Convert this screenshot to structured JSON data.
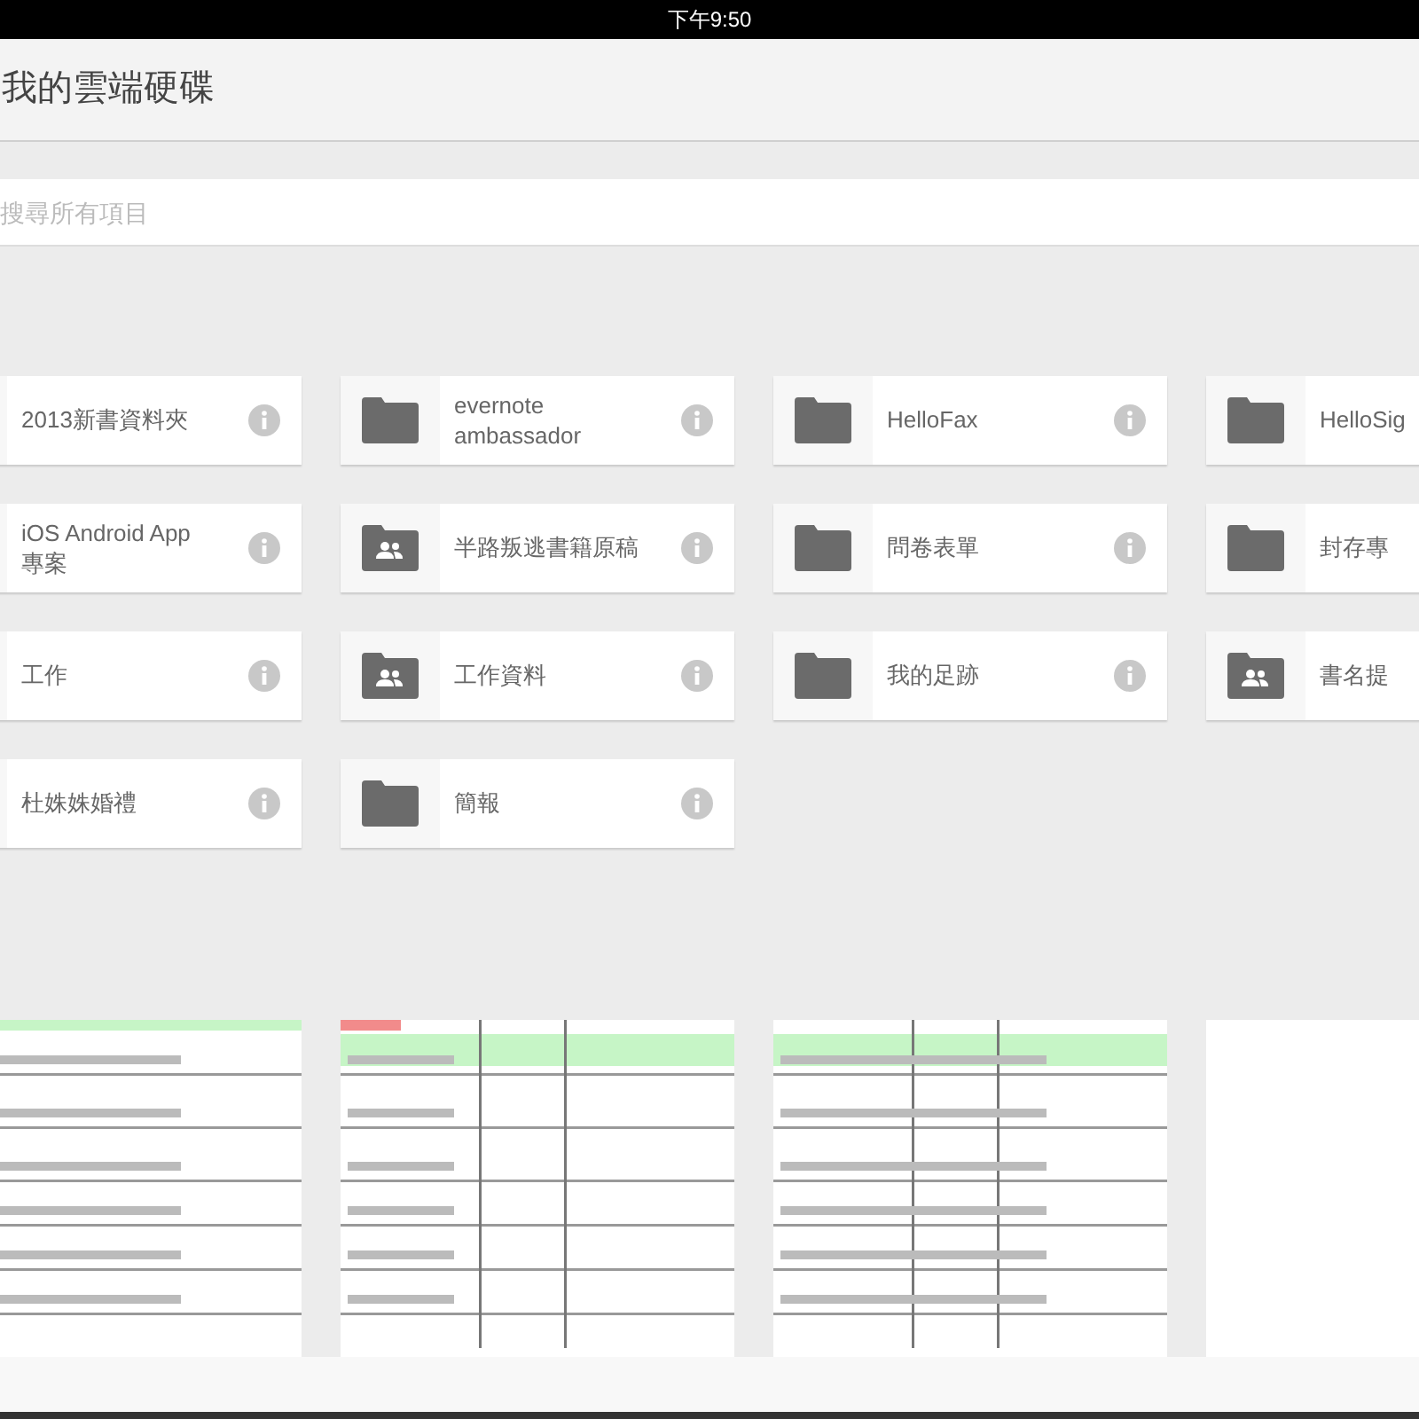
{
  "status_bar": {
    "time": "下午9:50"
  },
  "header": {
    "title": "我的雲端硬碟"
  },
  "search": {
    "placeholder": "搜尋所有項目"
  },
  "folders": [
    {
      "name": "2013新書資料夾"
    },
    {
      "name": "evernote ambassador",
      "kind": "folder"
    },
    {
      "name": "HelloFax",
      "kind": "folder"
    },
    {
      "name": "HelloSig",
      "kind": "folder"
    },
    {
      "name": "iOS Android App 專案"
    },
    {
      "name": "半路叛逃書籍原稿",
      "kind": "shared"
    },
    {
      "name": "問卷表單",
      "kind": "folder"
    },
    {
      "name": "封存專",
      "kind": "folder"
    },
    {
      "name": "工作"
    },
    {
      "name": "工作資料",
      "kind": "shared"
    },
    {
      "name": "我的足跡",
      "kind": "folder"
    },
    {
      "name": "書名提",
      "kind": "shared"
    },
    {
      "name": "杜姝姝婚禮"
    },
    {
      "name": "簡報",
      "kind": "folder"
    }
  ]
}
